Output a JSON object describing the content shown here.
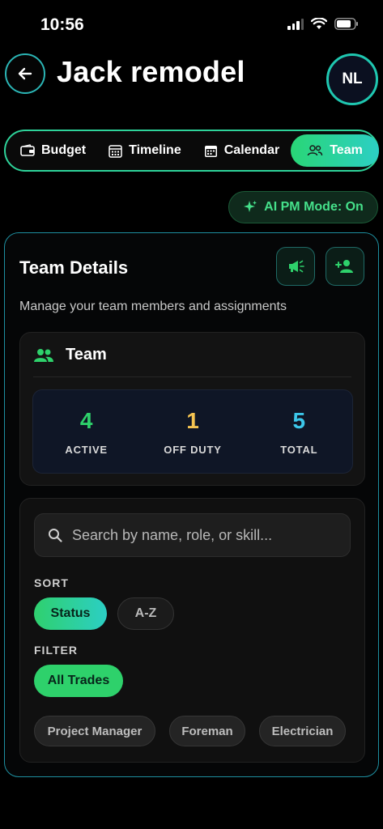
{
  "status_bar": {
    "time": "10:56"
  },
  "header": {
    "title": "Jack remodel",
    "avatar_initials": "NL"
  },
  "tabs": [
    {
      "label": "Budget",
      "icon": "wallet-icon",
      "active": false
    },
    {
      "label": "Timeline",
      "icon": "calendar-grid-icon",
      "active": false
    },
    {
      "label": "Calendar",
      "icon": "calendar-icon",
      "active": false
    },
    {
      "label": "Team",
      "icon": "people-icon",
      "active": true
    }
  ],
  "ai_mode": {
    "label": "AI PM Mode: On",
    "icon": "sparkle-icon"
  },
  "team_details": {
    "title": "Team Details",
    "subtitle": "Manage your team members and assignments",
    "actions": [
      "megaphone-icon",
      "add-person-icon"
    ]
  },
  "team_summary": {
    "heading": "Team",
    "stats": [
      {
        "value": "4",
        "label": "ACTIVE",
        "color": "#2ed16b"
      },
      {
        "value": "1",
        "label": "OFF DUTY",
        "color": "#f5c451"
      },
      {
        "value": "5",
        "label": "TOTAL",
        "color": "#3cc7ea"
      }
    ]
  },
  "search": {
    "placeholder": "Search by name, role, or skill..."
  },
  "sort": {
    "label": "SORT",
    "options": [
      "Status",
      "A-Z"
    ],
    "selected": "Status"
  },
  "filter": {
    "label": "FILTER",
    "selected": "All Trades",
    "trades": [
      "Project Manager",
      "Foreman",
      "Electrician"
    ]
  },
  "colors": {
    "accent_green": "#2ed16b",
    "accent_teal": "#2ccfc4",
    "border_teal": "#1e8fa0"
  }
}
